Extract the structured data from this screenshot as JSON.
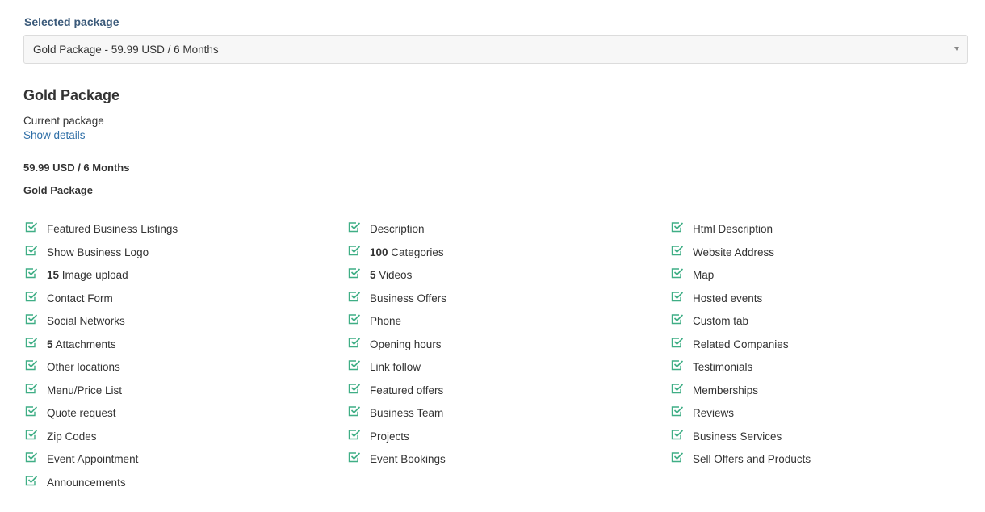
{
  "selected_package": {
    "label": "Selected package",
    "value": "Gold Package - 59.99 USD / 6 Months"
  },
  "package": {
    "title": "Gold Package",
    "status": "Current package",
    "details_link": "Show details",
    "price": "59.99 USD / 6 Months",
    "name": "Gold Package"
  },
  "colors": {
    "check": "#3fae85",
    "link": "#2f6fa7",
    "label": "#3b5a7a"
  },
  "features": {
    "columns": [
      [
        {
          "num": "",
          "text": "Featured Business Listings"
        },
        {
          "num": "",
          "text": "Show Business Logo"
        },
        {
          "num": "15",
          "text": "Image upload"
        },
        {
          "num": "",
          "text": "Contact Form"
        },
        {
          "num": "",
          "text": "Social Networks"
        },
        {
          "num": "5",
          "text": "Attachments"
        },
        {
          "num": "",
          "text": "Other locations"
        },
        {
          "num": "",
          "text": "Menu/Price List"
        },
        {
          "num": "",
          "text": "Quote request"
        },
        {
          "num": "",
          "text": "Zip Codes"
        },
        {
          "num": "",
          "text": "Event Appointment"
        },
        {
          "num": "",
          "text": "Announcements"
        }
      ],
      [
        {
          "num": "",
          "text": "Description"
        },
        {
          "num": "100",
          "text": "Categories"
        },
        {
          "num": "5",
          "text": "Videos"
        },
        {
          "num": "",
          "text": "Business Offers"
        },
        {
          "num": "",
          "text": "Phone"
        },
        {
          "num": "",
          "text": "Opening hours"
        },
        {
          "num": "",
          "text": "Link follow"
        },
        {
          "num": "",
          "text": "Featured offers"
        },
        {
          "num": "",
          "text": "Business Team"
        },
        {
          "num": "",
          "text": "Projects"
        },
        {
          "num": "",
          "text": "Event Bookings"
        }
      ],
      [
        {
          "num": "",
          "text": "Html Description"
        },
        {
          "num": "",
          "text": "Website Address"
        },
        {
          "num": "",
          "text": "Map"
        },
        {
          "num": "",
          "text": "Hosted events"
        },
        {
          "num": "",
          "text": "Custom tab"
        },
        {
          "num": "",
          "text": "Related Companies"
        },
        {
          "num": "",
          "text": "Testimonials"
        },
        {
          "num": "",
          "text": "Memberships"
        },
        {
          "num": "",
          "text": "Reviews"
        },
        {
          "num": "",
          "text": "Business Services"
        },
        {
          "num": "",
          "text": "Sell Offers and Products"
        }
      ]
    ]
  }
}
